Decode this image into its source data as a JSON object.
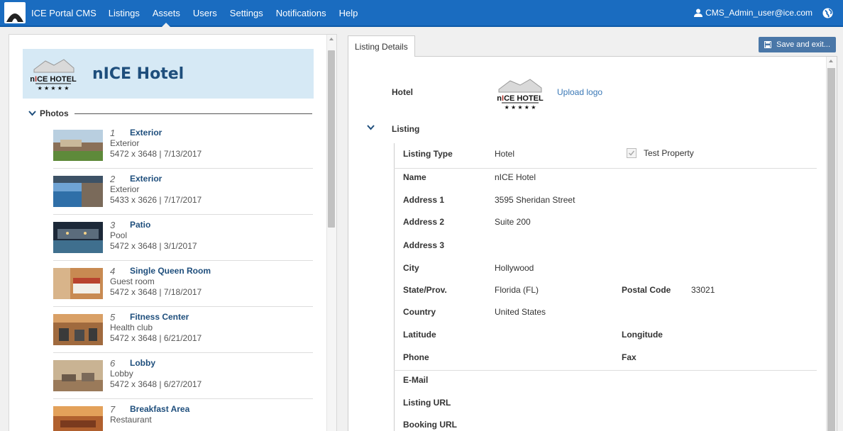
{
  "nav": {
    "brand": "ICE Portal CMS",
    "items": [
      {
        "label": "Listings"
      },
      {
        "label": "Assets"
      },
      {
        "label": "Users"
      },
      {
        "label": "Settings"
      },
      {
        "label": "Notifications"
      },
      {
        "label": "Help"
      }
    ],
    "active": "Assets",
    "user": "CMS_Admin_user@ice.com"
  },
  "hotel": {
    "name": "nICE Hotel"
  },
  "photos": {
    "section_label": "Photos",
    "items": [
      {
        "num": "1",
        "title": "Exterior",
        "category": "Exterior",
        "meta": "5472 x 3648 | 7/13/2017"
      },
      {
        "num": "2",
        "title": "Exterior",
        "category": "Exterior",
        "meta": "5433 x 3626 | 7/17/2017"
      },
      {
        "num": "3",
        "title": "Patio",
        "category": "Pool",
        "meta": "5472 x 3648 | 3/1/2017"
      },
      {
        "num": "4",
        "title": "Single Queen Room",
        "category": "Guest room",
        "meta": "5472 x 3648 | 7/18/2017"
      },
      {
        "num": "5",
        "title": "Fitness Center",
        "category": "Health club",
        "meta": "5472 x 3648 | 6/21/2017"
      },
      {
        "num": "6",
        "title": "Lobby",
        "category": "Lobby",
        "meta": "5472 x 3648 | 6/27/2017"
      },
      {
        "num": "7",
        "title": "Breakfast Area",
        "category": "Restaurant",
        "meta": ""
      }
    ]
  },
  "details": {
    "tab": "Listing Details",
    "save_label": "Save and exit...",
    "hotel_label": "Hotel",
    "upload_logo": "Upload logo",
    "listing_label": "Listing",
    "fields": {
      "listing_type": {
        "label": "Listing Type",
        "value": "Hotel"
      },
      "test_property": {
        "label": "Test Property",
        "checked": true
      },
      "name": {
        "label": "Name",
        "value": "nICE Hotel"
      },
      "address1": {
        "label": "Address 1",
        "value": "3595 Sheridan Street"
      },
      "address2": {
        "label": "Address 2",
        "value": "Suite 200"
      },
      "address3": {
        "label": "Address 3",
        "value": ""
      },
      "city": {
        "label": "City",
        "value": "Hollywood"
      },
      "state": {
        "label": "State/Prov.",
        "value": "Florida (FL)"
      },
      "postal": {
        "label": "Postal Code",
        "value": "33021"
      },
      "country": {
        "label": "Country",
        "value": "United States"
      },
      "latitude": {
        "label": "Latitude",
        "value": ""
      },
      "longitude": {
        "label": "Longitude",
        "value": ""
      },
      "phone": {
        "label": "Phone",
        "value": ""
      },
      "fax": {
        "label": "Fax",
        "value": ""
      },
      "email": {
        "label": "E-Mail",
        "value": ""
      },
      "listing_url": {
        "label": "Listing URL",
        "value": ""
      },
      "booking_url": {
        "label": "Booking URL",
        "value": ""
      }
    }
  },
  "colors": {
    "nav_bg": "#1a6cc0",
    "header_bg": "#d6e9f5",
    "title_blue": "#1e4e7c",
    "link_blue": "#3a78b6",
    "button_bg": "#4a77a8"
  },
  "icons": [
    "igloo-logo-icon",
    "user-icon",
    "globe-icon",
    "chevron-down-icon",
    "save-disk-icon",
    "checkbox-check-icon"
  ]
}
